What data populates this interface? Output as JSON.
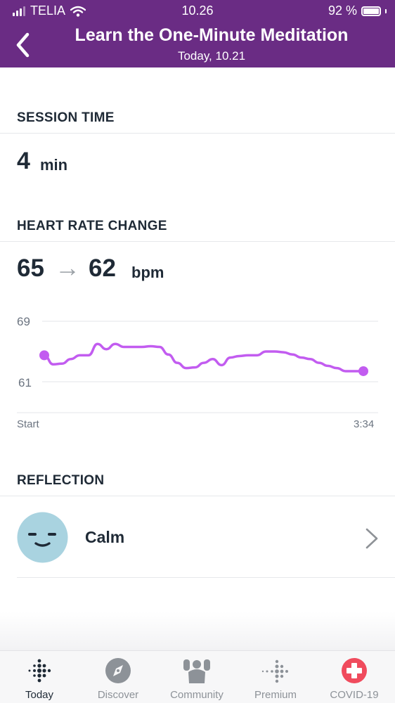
{
  "status_bar": {
    "carrier": "TELIA",
    "time": "10.26",
    "battery": "92 %"
  },
  "header": {
    "title": "Learn the One-Minute Meditation",
    "subtitle": "Today, 10.21"
  },
  "session_time": {
    "heading": "SESSION TIME",
    "value": "4",
    "unit": "min"
  },
  "heart_rate": {
    "heading": "HEART RATE CHANGE",
    "start_value": "65",
    "arrow": "→",
    "end_value": "62",
    "unit": "bpm"
  },
  "chart_data": {
    "type": "line",
    "y_ticks": [
      "69",
      "61"
    ],
    "ylim": [
      61,
      69
    ],
    "x_labels": [
      "Start",
      "3:34"
    ],
    "grid": true,
    "color": "#c25cf0",
    "x": [
      "0:00",
      "0:05",
      "0:10",
      "0:16",
      "0:22",
      "0:28",
      "0:34",
      "0:40",
      "0:46",
      "0:52",
      "0:58",
      "1:04",
      "1:10",
      "1:16",
      "1:22",
      "1:28",
      "1:34",
      "1:40",
      "1:46",
      "1:52",
      "1:58",
      "2:04",
      "2:10",
      "2:16",
      "2:22",
      "2:28",
      "2:34",
      "2:40",
      "2:46",
      "2:52",
      "2:58",
      "3:04",
      "3:10",
      "3:16",
      "3:22",
      "3:28",
      "3:34"
    ],
    "y": [
      64.5,
      63.3,
      63.4,
      64.0,
      64.5,
      64.5,
      66.0,
      65.3,
      66.0,
      65.6,
      65.6,
      65.6,
      65.7,
      65.6,
      64.6,
      63.5,
      62.8,
      62.9,
      63.5,
      64.0,
      63.2,
      64.2,
      64.4,
      64.5,
      64.5,
      65.0,
      65.0,
      64.9,
      64.6,
      64.2,
      64.0,
      63.5,
      63.1,
      62.8,
      62.4,
      62.4,
      62.4
    ],
    "series": [
      {
        "values": []
      }
    ],
    "endpoints": [
      "start",
      "end"
    ]
  },
  "reflection": {
    "heading": "REFLECTION",
    "mood": "Calm"
  },
  "colors": {
    "header": "#6a2c84",
    "line": "#c25cf0",
    "mood_face": "#a9d3e0",
    "covid": "#f04b5d"
  },
  "tabs": [
    {
      "label": "Today",
      "icon": "fitbit-dots-icon",
      "active": true
    },
    {
      "label": "Discover",
      "icon": "compass-icon",
      "active": false
    },
    {
      "label": "Community",
      "icon": "community-icon",
      "active": false
    },
    {
      "label": "Premium",
      "icon": "premium-dots-icon",
      "active": false
    },
    {
      "label": "COVID-19",
      "icon": "covid-cross-icon",
      "active": false
    }
  ]
}
